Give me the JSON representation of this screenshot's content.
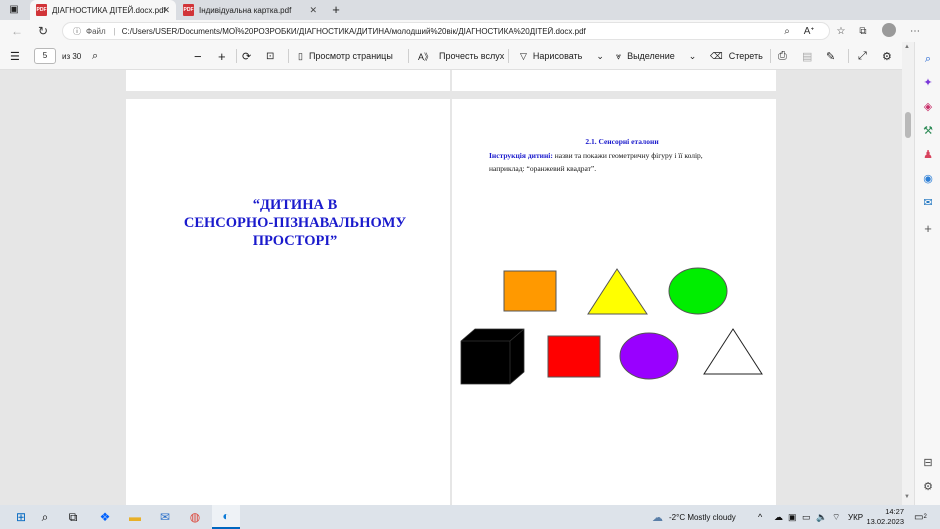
{
  "browser": {
    "tabs": [
      {
        "title": "ДІАГНОСТИКА ДІТЕЙ.docx.pdf",
        "active": true
      },
      {
        "title": "Індивідуальна картка.pdf",
        "active": false
      }
    ],
    "address": {
      "label": "Файл",
      "url": "C:/Users/USER/Documents/МОЇ%20РОЗРОБКИ/ДІАГНОСТИКА/ДИТИНА/молодший%20вік/ДІАГНОСТИКА%20ДІТЕЙ.docx.pdf"
    }
  },
  "pdf_toolbar": {
    "page_current": "5",
    "page_total": "из 30",
    "page_view": "Просмотр страницы",
    "read_aloud": "Прочесть вслух",
    "draw": "Нарисовать",
    "highlight": "Выделение",
    "erase": "Стереть"
  },
  "document": {
    "left_title": [
      "“ДИТИНА В",
      "СЕНСОРНО-ПІЗНАВАЛЬНОМУ",
      "ПРОСТОРІ”"
    ],
    "section_heading": "2.1. Сенсорні еталони",
    "instruction_label": "Інструкція дитині:",
    "instruction_text": " назви та покажи геометричну фігуру і її колір,",
    "instruction_line2": "наприклад: “оранжевий квадрат”.",
    "shapes": [
      {
        "name": "orange-square",
        "color": "#FF9900"
      },
      {
        "name": "yellow-triangle",
        "color": "#FFFF00"
      },
      {
        "name": "green-oval",
        "color": "#00EE00"
      },
      {
        "name": "black-cube",
        "color": "#000000"
      },
      {
        "name": "red-rectangle",
        "color": "#FF0000"
      },
      {
        "name": "purple-oval",
        "color": "#9900FF"
      },
      {
        "name": "white-triangle",
        "color": "#FFFFFF"
      }
    ]
  },
  "taskbar": {
    "weather": "-2°C  Mostly cloudy",
    "language": "УКР",
    "time": "14:27",
    "date": "13.02.2023",
    "notifications": "2"
  }
}
